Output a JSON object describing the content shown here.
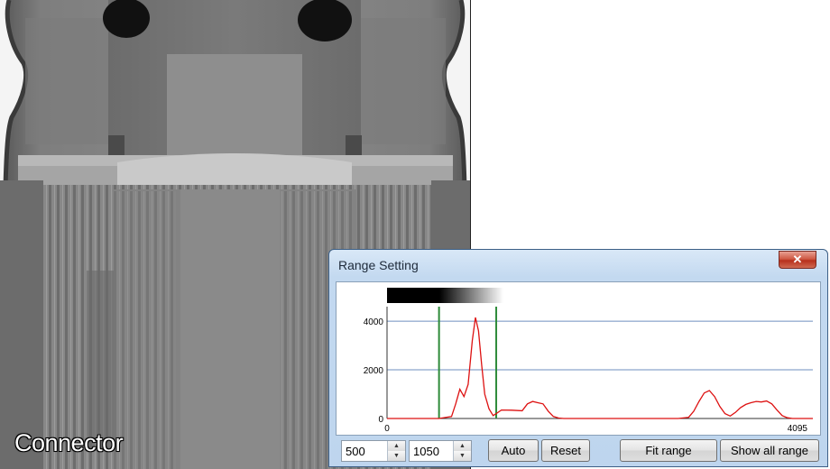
{
  "image": {
    "label": "Connector"
  },
  "dialog": {
    "title": "Range Setting",
    "close_symbol": "✕",
    "low_value": "500",
    "high_value": "1050",
    "buttons": {
      "auto": "Auto",
      "reset": "Reset",
      "fit_range": "Fit range",
      "show_all_range": "Show all range"
    }
  },
  "colors": {
    "histogram_line": "#dd1111",
    "range_markers": "#2e8b3a",
    "gridlines": "#6f8fbf"
  },
  "chart_data": {
    "type": "line",
    "x_ticks": [
      "0",
      "4095"
    ],
    "y_ticks": [
      "0",
      "2000",
      "4000"
    ],
    "xlim": [
      0,
      4095
    ],
    "ylim": [
      0,
      4300
    ],
    "grid": true,
    "range_markers": [
      500,
      1050
    ],
    "grayscale_bar_span": [
      0,
      1050
    ],
    "series": [
      {
        "x": [
          0,
          500,
          620,
          660,
          700,
          740,
          780,
          820,
          850,
          880,
          910,
          940,
          980,
          1020,
          1050,
          1100,
          1200,
          1300,
          1350,
          1400,
          1450,
          1500,
          1550,
          1600,
          1650,
          1700,
          1800,
          2000,
          2200,
          2400,
          2600,
          2800,
          2900,
          2950,
          3000,
          3050,
          3100,
          3150,
          3200,
          3250,
          3300,
          3350,
          3400,
          3450,
          3500,
          3550,
          3600,
          3650,
          3700,
          3750,
          3800,
          3850,
          3900,
          4095
        ],
        "y": [
          0,
          0,
          80,
          600,
          1200,
          900,
          1400,
          3200,
          4150,
          3600,
          2200,
          1000,
          400,
          120,
          200,
          350,
          340,
          320,
          600,
          700,
          650,
          600,
          300,
          80,
          20,
          0,
          0,
          0,
          0,
          0,
          0,
          0,
          50,
          300,
          700,
          1050,
          1150,
          900,
          500,
          200,
          100,
          250,
          450,
          580,
          650,
          700,
          680,
          720,
          600,
          350,
          120,
          30,
          0,
          0
        ]
      }
    ]
  }
}
